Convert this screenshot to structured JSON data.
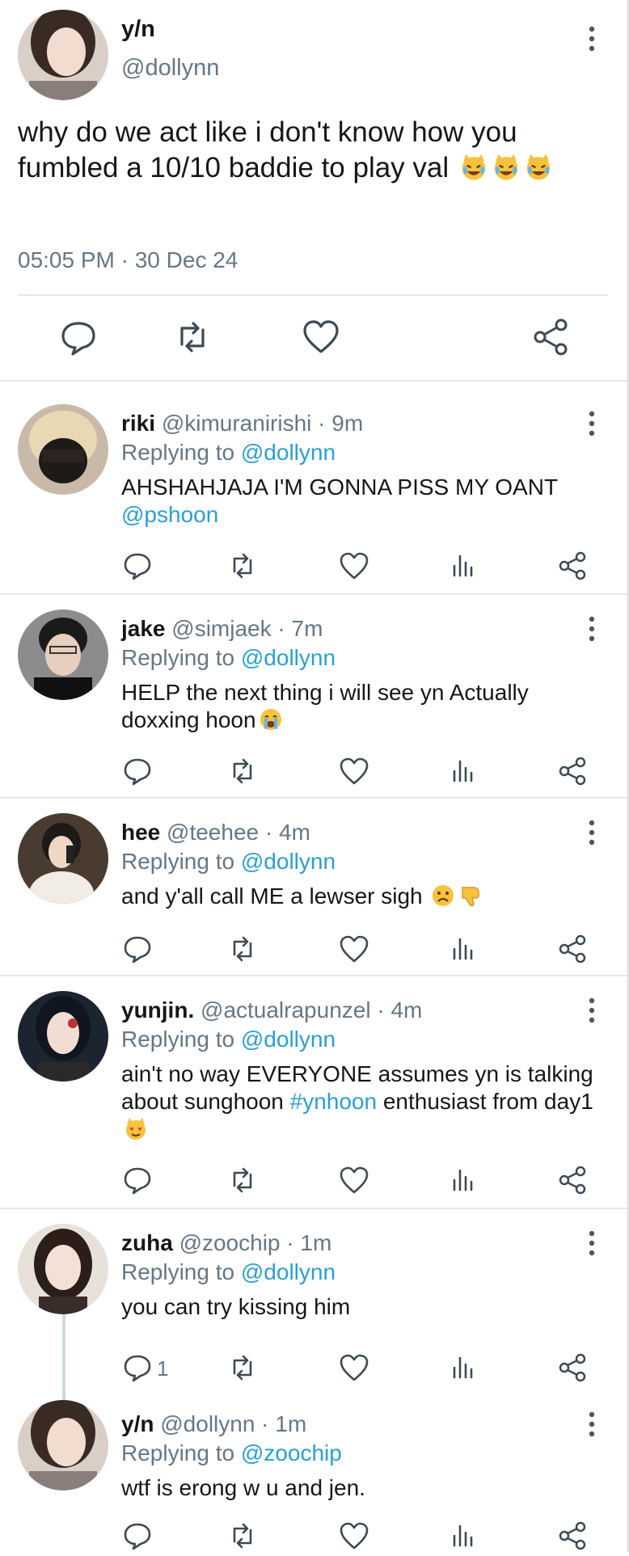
{
  "main_tweet": {
    "name": "y/n",
    "handle": "@dollynn",
    "text": "why do we act like i don't know how you fumbled a 10/10 baddie to play val",
    "timestamp": "05:05 PM · 30 Dec 24",
    "emojis": [
      "joy-cat-emoji",
      "joy-cat-emoji",
      "joy-cat-emoji"
    ]
  },
  "replies": [
    {
      "name": "riki",
      "handle": "@kimuranirishi",
      "time": "9m",
      "replying_label": "Replying to",
      "replying_to": "@dollynn",
      "text": "AHSHAHJAJA I'M GONNA PISS MY OANT",
      "mention": "@pshoon"
    },
    {
      "name": "jake",
      "handle": "@simjaek",
      "time": "7m",
      "replying_label": "Replying to",
      "replying_to": "@dollynn",
      "text": "HELP the next thing i will see yn Actually doxxing hoon",
      "emoji": "loudly-crying-emoji"
    },
    {
      "name": "hee",
      "handle": "@teehee",
      "time": "4m",
      "replying_label": "Replying to",
      "replying_to": "@dollynn",
      "text": "and y'all call ME a lewser sigh",
      "emoji": "frowning-and-thumbs-down-emoji"
    },
    {
      "name": "yunjin.",
      "handle": "@actualrapunzel",
      "time": "4m",
      "replying_label": "Replying to",
      "replying_to": "@dollynn",
      "text_before": "ain't no way EVERYONE assumes yn is talking about sunghoon",
      "hashtag": "#ynhoon",
      "text_after": "enthusiast from day1",
      "emoji": "heart-eyes-cat-emoji"
    },
    {
      "name": "zuha",
      "handle": "@zoochip",
      "time": "1m",
      "replying_label": "Replying to",
      "replying_to": "@dollynn",
      "text": "you can try kissing him",
      "reply_count": "1"
    },
    {
      "name": "y/n",
      "handle": "@dollynn",
      "time": "1m",
      "replying_label": "Replying to",
      "replying_to": "@zoochip",
      "text": "wtf is erong w u and jen."
    }
  ],
  "colors": {
    "link": "#2a9fd6",
    "secondary": "#657786",
    "divider": "#e1e8ed"
  }
}
